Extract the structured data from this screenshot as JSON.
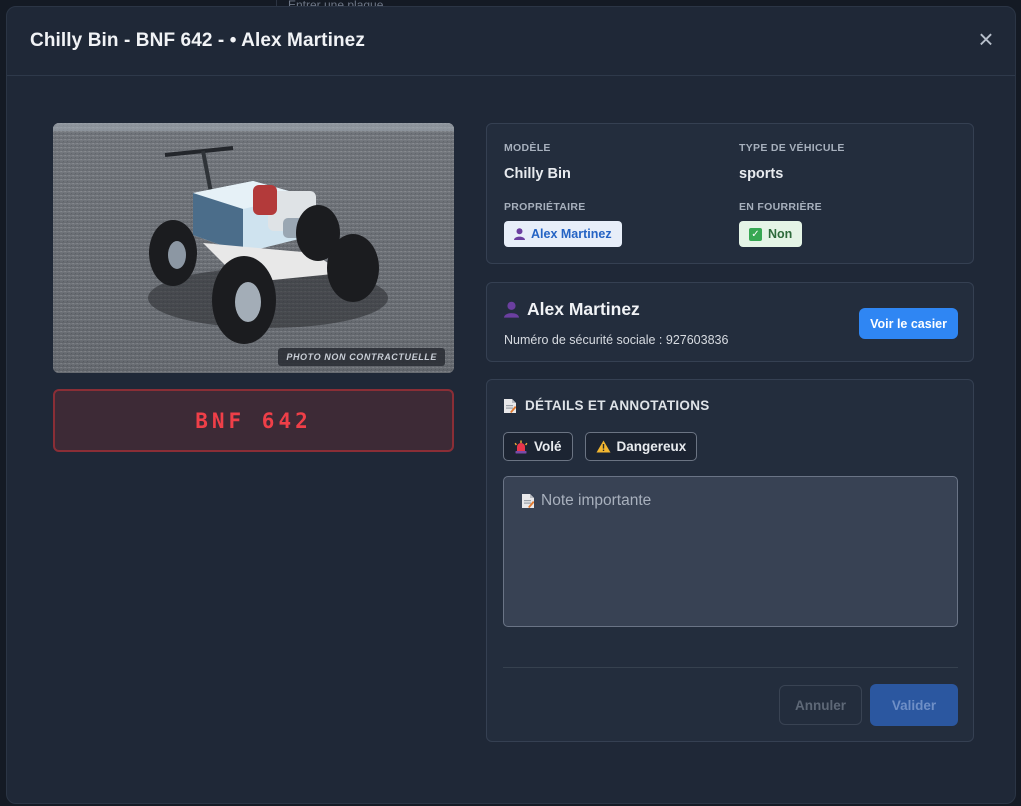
{
  "backdrop": {
    "search_placeholder": "Entrer une plaque"
  },
  "header": {
    "title": "Chilly Bin - BNF 642 - • Alex Martinez",
    "close_symbol": "×"
  },
  "vehicle": {
    "photo_badge": "PHOTO NON CONTRACTUELLE",
    "plate": "BNF 642"
  },
  "info": {
    "model_label": "MODÈLE",
    "model_value": "Chilly Bin",
    "type_label": "TYPE DE VÉHICULE",
    "type_value": "sports",
    "owner_label": "PROPRIÉTAIRE",
    "owner_value": "Alex Martinez",
    "impound_label": "EN FOURRIÈRE",
    "impound_value": "Non"
  },
  "owner_card": {
    "name": "Alex Martinez",
    "ssn_text": "Numéro de sécurité sociale : 927603836",
    "button_label": "Voir le casier"
  },
  "details": {
    "title": "DÉTAILS ET ANNOTATIONS",
    "tags": [
      {
        "label": "Volé",
        "icon": "siren-icon"
      },
      {
        "label": "Dangereux",
        "icon": "warning-icon"
      }
    ],
    "note_placeholder": "Note importante",
    "cancel_label": "Annuler",
    "validate_label": "Valider"
  },
  "colors": {
    "accent": "#2f86f3",
    "plate_text": "#ef3f48",
    "modal_bg": "#1f2837"
  }
}
